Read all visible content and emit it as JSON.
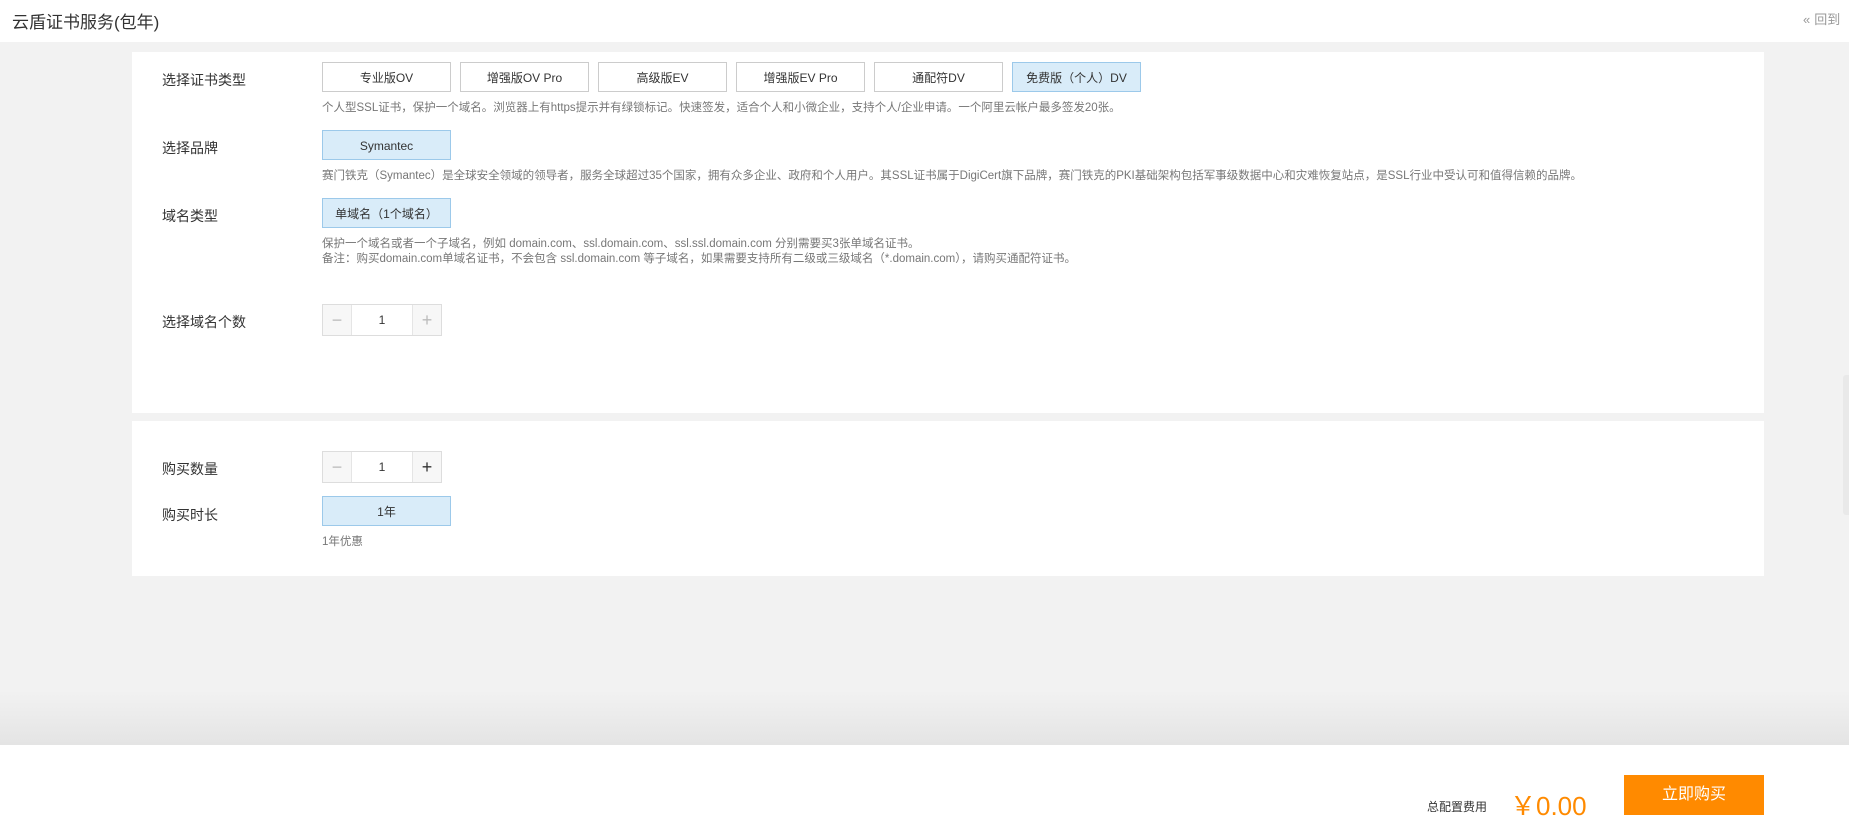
{
  "header": {
    "title": "云盾证书服务(包年)",
    "back_label": "回到"
  },
  "cert_type": {
    "label": "选择证书类型",
    "options": [
      "专业版OV",
      "增强版OV Pro",
      "高级版EV",
      "增强版EV Pro",
      "通配符DV",
      "免费版（个人）DV"
    ],
    "selected": "免费版（个人）DV",
    "description": "个人型SSL证书，保护一个域名。浏览器上有https提示并有绿锁标记。快速签发，适合个人和小微企业，支持个人/企业申请。一个阿里云帐户最多签发20张。"
  },
  "brand": {
    "label": "选择品牌",
    "options": [
      "Symantec"
    ],
    "selected": "Symantec",
    "description": "赛门铁克（Symantec）是全球安全领域的领导者，服务全球超过35个国家，拥有众多企业、政府和个人用户。其SSL证书属于DigiCert旗下品牌，赛门铁克的PKI基础架构包括军事级数据中心和灾难恢复站点，是SSL行业中受认可和值得信赖的品牌。"
  },
  "domain_type": {
    "label": "域名类型",
    "options": [
      "单域名（1个域名）"
    ],
    "selected": "单域名（1个域名）",
    "desc_line1": "保护一个域名或者一个子域名，例如 domain.com、ssl.domain.com、ssl.ssl.domain.com 分别需要买3张单域名证书。",
    "desc_line2": "备注：购买domain.com单域名证书，不会包含 ssl.domain.com 等子域名，如果需要支持所有二级或三级域名（*.domain.com），请购买通配符证书。"
  },
  "domain_count": {
    "label": "选择域名个数",
    "value": "1",
    "minus": "−",
    "plus": "+"
  },
  "quantity": {
    "label": "购买数量",
    "value": "1",
    "minus": "−",
    "plus": "+"
  },
  "duration": {
    "label": "购买时长",
    "options": [
      "1年"
    ],
    "selected": "1年",
    "note": "1年优惠"
  },
  "footer": {
    "total_label": "总配置费用",
    "total_price": "￥0.00",
    "buy_label": "立即购买"
  },
  "colors": {
    "accent": "#ff8a00",
    "selected_bg": "#d9ecf9",
    "selected_border": "#9cc9ea"
  },
  "icons": {
    "back": "double-chevron-left-icon",
    "minus": "minus-icon",
    "plus": "plus-icon"
  }
}
